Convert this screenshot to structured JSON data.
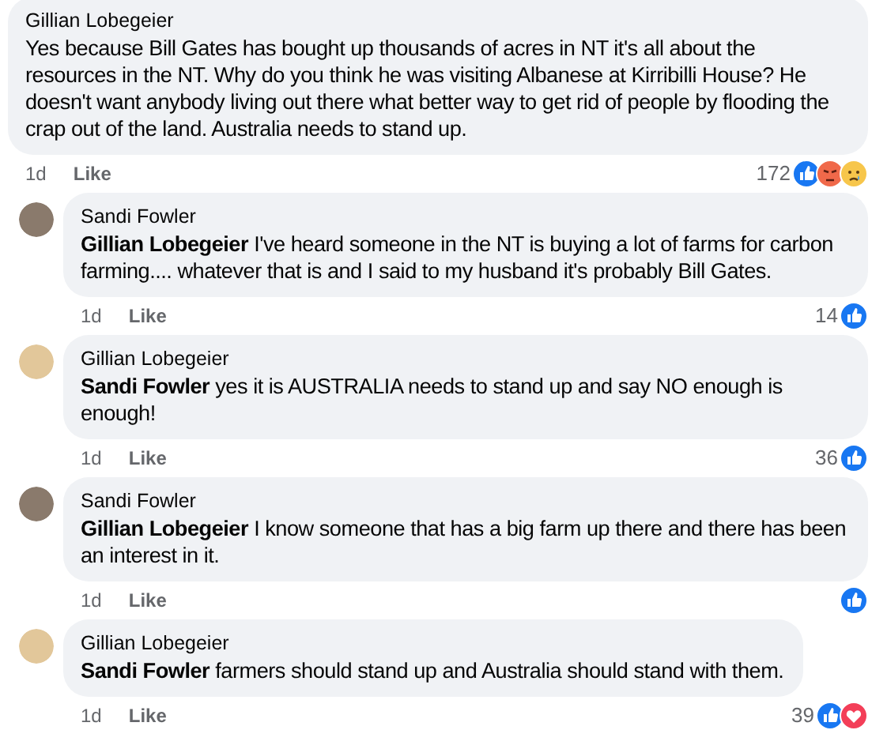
{
  "comments": [
    {
      "kind": "comment",
      "author": "Gillian Lobegeier",
      "text": "Yes because Bill Gates has bought up thousands of acres in NT it's all about the resources in the NT. Why do you think he was visiting Albanese at Kirribilli House? He doesn't want anybody living out there what better way to get rid of people by flooding the crap out of the land. Australia needs to stand up.",
      "time": "1d",
      "action": "Like",
      "count": "172",
      "reactions": [
        {
          "kind": "like"
        },
        {
          "kind": "angry"
        },
        {
          "kind": "sad"
        }
      ]
    },
    {
      "kind": "reply",
      "color": "#8a7a6c",
      "author": "Sandi Fowler",
      "text": "**Gillian Lobegeier** I've heard someone in the NT is buying a lot of farms for carbon farming.... whatever that is and I said to my husband it's probably Bill Gates.",
      "time": "1d",
      "action": "Like",
      "count": "14",
      "reactions": [
        {
          "kind": "like"
        }
      ]
    },
    {
      "kind": "reply",
      "color": "#e2c79a",
      "author": "Gillian Lobegeier",
      "text": "**Sandi Fowler** yes it is AUSTRALIA needs to stand up and say NO enough is enough!",
      "time": "1d",
      "action": "Like",
      "count": "36",
      "reactions": [
        {
          "kind": "like"
        }
      ]
    },
    {
      "kind": "reply",
      "color": "#8a7a6c",
      "author": "Sandi Fowler",
      "text": "**Gillian Lobegeier** I know someone that has a big farm up there and there has been an interest in it.",
      "time": "1d",
      "action": "Like",
      "reactions": [
        {
          "kind": "like"
        }
      ]
    },
    {
      "kind": "reply",
      "color": "#e2c79a",
      "author": "Gillian Lobegeier",
      "text": "**Sandi Fowler** farmers should stand up and Australia should stand with them.",
      "time": "1d",
      "action": "Like",
      "count": "39",
      "reactions": [
        {
          "kind": "like"
        },
        {
          "kind": "heart"
        }
      ]
    }
  ]
}
